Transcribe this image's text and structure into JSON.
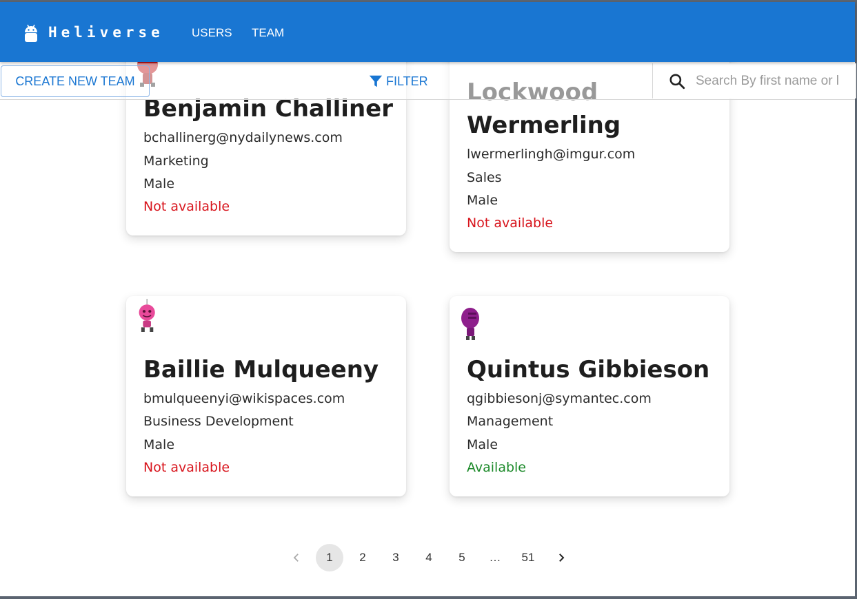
{
  "app": {
    "brand": "Heliverse",
    "nav": [
      {
        "label": "USERS"
      },
      {
        "label": "TEAM"
      }
    ],
    "accent": "#1976d2"
  },
  "toolbar": {
    "create_label": "CREATE NEW TEAM",
    "filter_label": "FILTER",
    "search_placeholder": "Search By first name or l"
  },
  "cards": [
    {
      "name": "Benjamin Challiner",
      "email": "bchallinerg@nydailynews.com",
      "domain": "Marketing",
      "gender": "Male",
      "status": "Not available",
      "avatar_color": "#c0181c"
    },
    {
      "name": "Lockwood Wermerling",
      "email": "lwermerlingh@imgur.com",
      "domain": "Sales",
      "gender": "Male",
      "status": "Not available"
    },
    {
      "name": "Baillie Mulqueeny",
      "email": "bmulqueenyi@wikispaces.com",
      "domain": "Business Development",
      "gender": "Male",
      "status": "Not available",
      "avatar_color": "#e84a9a"
    },
    {
      "name": "Quintus Gibbieson",
      "email": "qgibbiesonj@symantec.com",
      "domain": "Management",
      "gender": "Male",
      "status": "Available",
      "avatar_color": "#8e1f8c"
    }
  ],
  "pagination": {
    "pages": [
      "1",
      "2",
      "3",
      "4",
      "5",
      "…",
      "51"
    ],
    "current": "1"
  },
  "status_colors": {
    "available": "#1c8a2a",
    "not_available": "#d8141c"
  }
}
